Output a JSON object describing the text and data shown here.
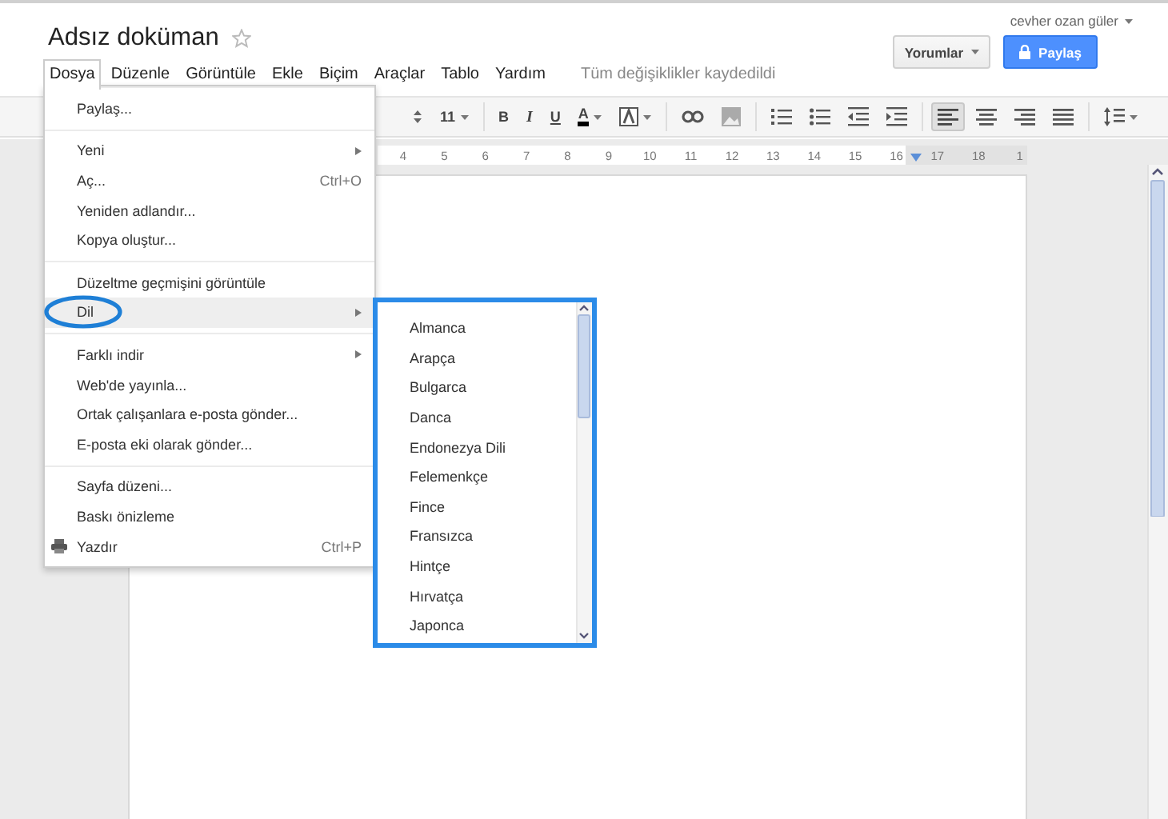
{
  "header": {
    "title": "Adsız doküman",
    "starred": false,
    "user": "cevher ozan güler",
    "comments_button": "Yorumlar",
    "share_button": "Paylaş",
    "save_status": "Tüm değişiklikler kaydedildi"
  },
  "menubar": [
    {
      "label": "Dosya",
      "selected": true
    },
    {
      "label": "Düzenle",
      "selected": false
    },
    {
      "label": "Görüntüle",
      "selected": false
    },
    {
      "label": "Ekle",
      "selected": false
    },
    {
      "label": "Biçim",
      "selected": false
    },
    {
      "label": "Araçlar",
      "selected": false
    },
    {
      "label": "Tablo",
      "selected": false
    },
    {
      "label": "Yardım",
      "selected": false
    }
  ],
  "toolbar": [
    {
      "kind": "spinner"
    },
    {
      "kind": "text",
      "label": "11",
      "caret": true
    },
    {
      "kind": "bold",
      "label": "B"
    },
    {
      "kind": "italic",
      "label": "I"
    },
    {
      "kind": "underline",
      "label": "U"
    },
    {
      "kind": "color",
      "label": "A",
      "caret": true
    },
    {
      "kind": "highlight",
      "caret": true
    },
    {
      "kind": "link"
    },
    {
      "kind": "image"
    },
    {
      "kind": "numlist"
    },
    {
      "kind": "bullets"
    },
    {
      "kind": "outdent"
    },
    {
      "kind": "indent"
    },
    {
      "kind": "align-left",
      "selected": true
    },
    {
      "kind": "align-center",
      "selected": false
    },
    {
      "kind": "align-right",
      "selected": false
    },
    {
      "kind": "justify",
      "selected": false
    },
    {
      "kind": "spacing",
      "caret": true
    }
  ],
  "ruler": [
    "4",
    "5",
    "6",
    "7",
    "8",
    "9",
    "10",
    "11",
    "12",
    "13",
    "14",
    "15",
    "16",
    "17",
    "18",
    "1"
  ],
  "file_menu": [
    [
      {
        "label": "Paylaş..."
      }
    ],
    [
      {
        "label": "Yeni",
        "submenu": true
      },
      {
        "label": "Aç...",
        "shortcut": "Ctrl+O"
      },
      {
        "label": "Yeniden adlandır..."
      },
      {
        "label": "Kopya oluştur..."
      }
    ],
    [
      {
        "label": "Düzeltme geçmişini görüntüle"
      },
      {
        "label": "Dil",
        "submenu": true,
        "selected": true,
        "circled": true
      }
    ],
    [
      {
        "label": "Farklı indir",
        "submenu": true
      },
      {
        "label": "Web'de yayınla..."
      },
      {
        "label": "Ortak çalışanlara e-posta gönder..."
      },
      {
        "label": "E-posta eki olarak gönder..."
      }
    ],
    [
      {
        "label": "Sayfa düzeni..."
      },
      {
        "label": "Baskı önizleme"
      },
      {
        "label": "Yazdır",
        "shortcut": "Ctrl+P",
        "kind": "print"
      }
    ]
  ],
  "language_menu": {
    "highlighted": true,
    "items": [
      "Almanca",
      "Arapça",
      "Bulgarca",
      "Danca",
      "Endonezya Dili",
      "Felemenkçe",
      "Fince",
      "Fransızca",
      "Hintçe",
      "Hırvatça",
      "Japonca"
    ]
  }
}
